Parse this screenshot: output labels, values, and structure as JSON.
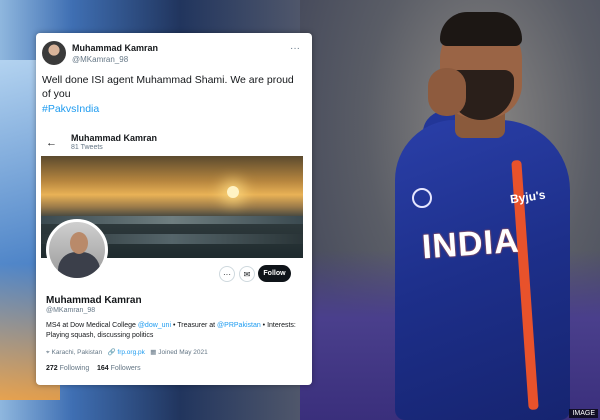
{
  "tweet": {
    "author_name": "Muhammad Kamran",
    "author_handle": "@MKamran_98",
    "more_glyph": "···",
    "text": "Well done ISI agent Muhammad Shami. We are proud of you",
    "hashtag": "#PakvsIndia"
  },
  "profile": {
    "back_glyph": "←",
    "top_name": "Muhammad Kamran",
    "tweets_count": "81 Tweets",
    "name": "Muhammad Kamran",
    "handle": "@MKamran_98",
    "bio_text": "MS4 at Dow Medical College ",
    "bio_link1": "@dow_uni",
    "bio_mid": " • Treasurer at ",
    "bio_link2": "@PRPakistan",
    "bio_end": " • Interests: Playing squash, discussing politics",
    "location": "Karachi, Pakistan",
    "website": "frp.org.pk",
    "joined": "Joined May 2021",
    "following_count": "272",
    "following_label": "Following",
    "followers_count": "164",
    "followers_label": "Followers",
    "follow_button": "Follow",
    "more_button_glyph": "···",
    "message_button_glyph": "✉"
  },
  "photo": {
    "jersey_text": "INDIA",
    "sponsor_text": "Byju's",
    "image_tag": "IMAGE"
  },
  "colors": {
    "link": "#1d9bf0",
    "jersey": "#1d2f8a",
    "stripe": "#e8522b"
  }
}
